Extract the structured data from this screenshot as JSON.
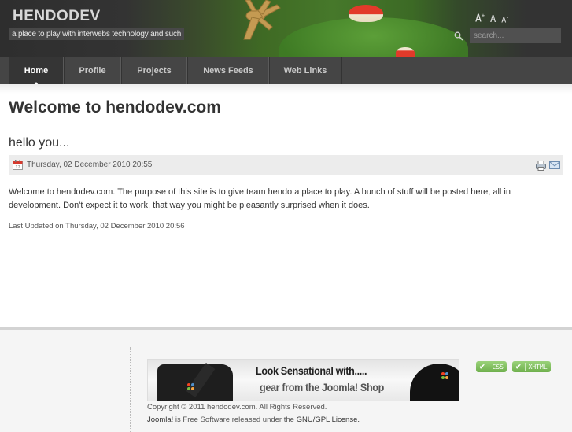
{
  "header": {
    "site_title": "HENDODEV",
    "tagline": "a place to play with interwebs technology and such",
    "font_sizer": {
      "increase": "A",
      "increase_sup": "+",
      "reset": "A",
      "decrease": "A",
      "decrease_sup": "-"
    },
    "search": {
      "placeholder": "search...",
      "value": ""
    }
  },
  "nav": {
    "items": [
      {
        "label": "Home",
        "active": true
      },
      {
        "label": "Profile",
        "active": false
      },
      {
        "label": "Projects",
        "active": false
      },
      {
        "label": "News Feeds",
        "active": false
      },
      {
        "label": "Web Links",
        "active": false
      }
    ]
  },
  "main": {
    "page_title": "Welcome to hendodev.com",
    "article": {
      "title": "hello you...",
      "created": "Thursday, 02 December 2010 20:55",
      "body": "Welcome to hendodev.com. The purpose of this site is to give team hendo a place to play. A bunch of stuff will be posted here, all in development. Don't expect it to work, that way you might be pleasantly surprised when it does.",
      "last_updated": "Last Updated on Thursday, 02 December 2010 20:56",
      "icons": [
        "calendar-icon",
        "print-icon",
        "email-icon"
      ]
    }
  },
  "footer": {
    "banner": {
      "line1": "Look Sensational with.....",
      "line2": "gear from the Joomla! Shop"
    },
    "badges": [
      {
        "label": "CSS"
      },
      {
        "label": "XHTML"
      }
    ],
    "copyright": "Copyright © 2011 hendodev.com. All Rights Reserved.",
    "license": {
      "joomla_link": "Joomla!",
      "middle": " is Free Software released under the ",
      "gpl_link": "GNU/GPL License."
    }
  },
  "colors": {
    "nav_bg": "#454545",
    "nav_active_bg": "#353535",
    "meta_bar_bg": "#ececec",
    "footer_bg": "#f5f5f5",
    "badge_green": "#7fbf5c"
  }
}
